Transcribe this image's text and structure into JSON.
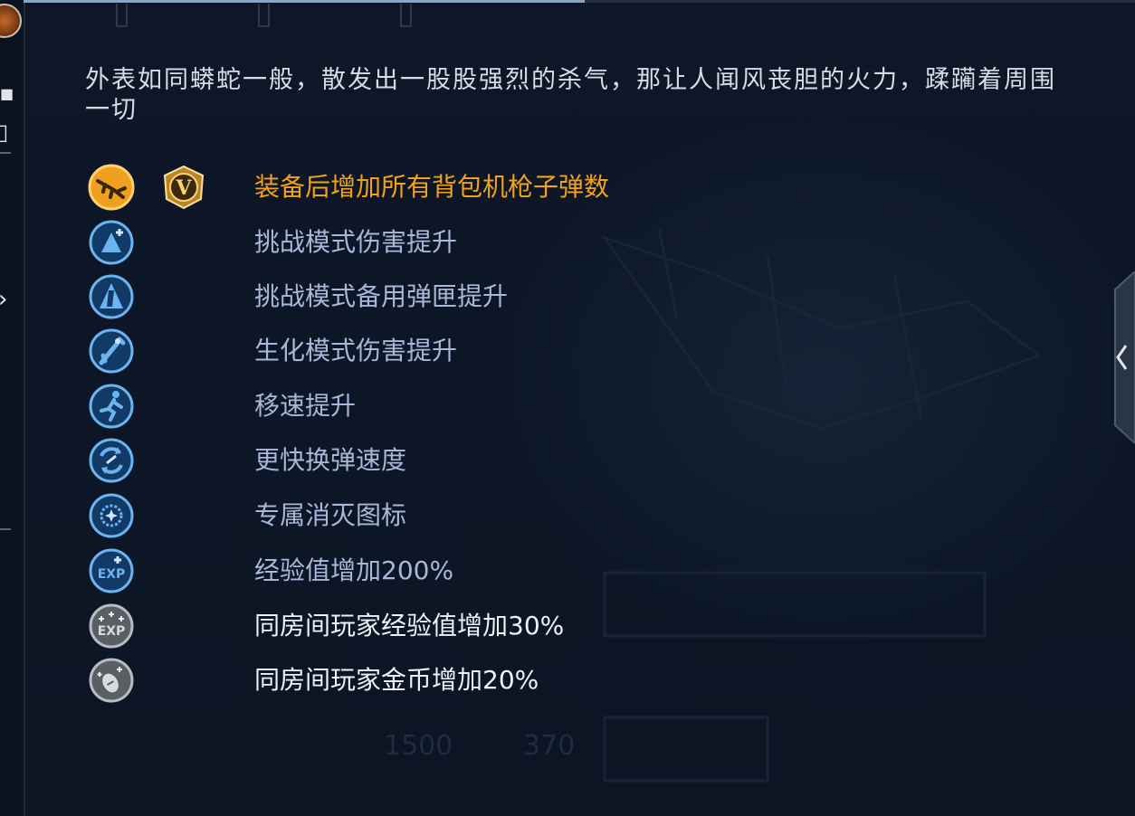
{
  "item": {
    "description": "外表如同蟒蛇一般，散发出一股股强烈的杀气，那让人闻风丧胆的火力，蹂躏着周围一切"
  },
  "colors": {
    "highlight_text": "#f2a21a",
    "normal_text": "#a7b8d8",
    "white_text": "#eef1f5",
    "icon_orange": "#f0a020",
    "icon_blue": "#2e7fc8",
    "icon_gray": "#8a8f96"
  },
  "features": [
    {
      "label": "装备后增加所有背包机枪子弹数",
      "icon": "machine-gun-icon",
      "style": "orange",
      "badge": "V"
    },
    {
      "label": "挑战模式伤害提升",
      "icon": "damage-up-icon",
      "style": "blue"
    },
    {
      "label": "挑战模式备用弹匣提升",
      "icon": "magazine-up-icon",
      "style": "blue"
    },
    {
      "label": "生化模式伤害提升",
      "icon": "zombie-damage-icon",
      "style": "blue"
    },
    {
      "label": "移速提升",
      "icon": "running-man-icon",
      "style": "blue"
    },
    {
      "label": "更快换弹速度",
      "icon": "fast-reload-icon",
      "style": "blue"
    },
    {
      "label": "专属消灭图标",
      "icon": "kill-mark-icon",
      "style": "blue"
    },
    {
      "label": "经验值增加200%",
      "icon": "exp-plus-icon",
      "style": "blue"
    },
    {
      "label": "同房间玩家经验值增加30%",
      "icon": "room-exp-icon",
      "style": "gray"
    },
    {
      "label": "同房间玩家金币增加20%",
      "icon": "room-coin-icon",
      "style": "gray"
    }
  ],
  "background_stats": [
    "1500",
    "370"
  ]
}
